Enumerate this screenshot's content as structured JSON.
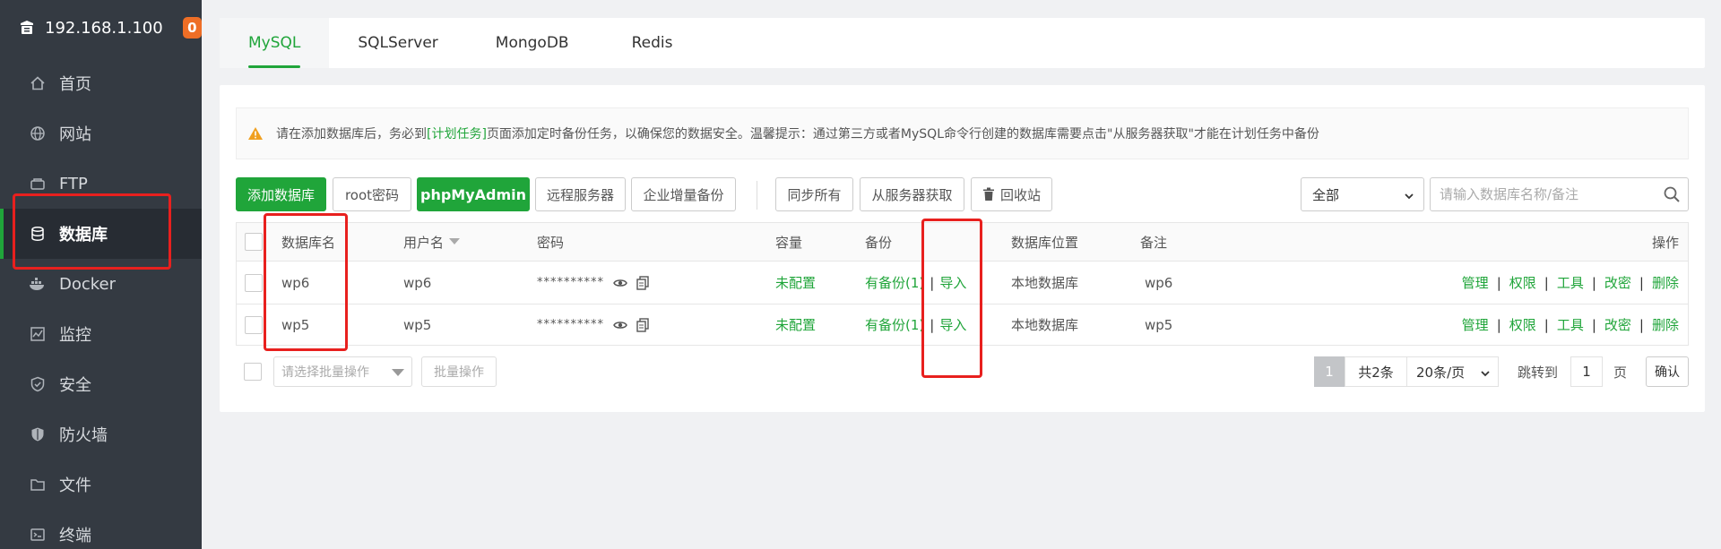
{
  "sidebar": {
    "host": "192.168.1.100",
    "badge": "0",
    "items": [
      {
        "label": "首页",
        "icon": "home-icon"
      },
      {
        "label": "网站",
        "icon": "globe-icon"
      },
      {
        "label": "FTP",
        "icon": "ftp-icon"
      },
      {
        "label": "数据库",
        "icon": "database-icon"
      },
      {
        "label": "Docker",
        "icon": "docker-icon"
      },
      {
        "label": "监控",
        "icon": "monitor-icon"
      },
      {
        "label": "安全",
        "icon": "shield-icon"
      },
      {
        "label": "防火墙",
        "icon": "firewall-icon"
      },
      {
        "label": "文件",
        "icon": "folder-icon"
      },
      {
        "label": "终端",
        "icon": "terminal-icon"
      }
    ]
  },
  "tabs": [
    "MySQL",
    "SQLServer",
    "MongoDB",
    "Redis"
  ],
  "notice": {
    "pre": "请在添加数据库后，务必到",
    "link": "[计划任务]",
    "post": "页面添加定时备份任务，以确保您的数据安全。温馨提示：通过第三方或者MySQL命令行创建的数据库需要点击\"从服务器获取\"才能在计划任务中备份"
  },
  "toolbar": {
    "add_db": "添加数据库",
    "root_pwd": "root密码",
    "phpmyadmin": "phpMyAdmin",
    "remote_server": "远程服务器",
    "incremental_backup": "企业增量备份",
    "sync_all": "同步所有",
    "fetch_from_server": "从服务器获取",
    "recycle_bin": "回收站",
    "filter_value": "全部",
    "search_placeholder": "请输入数据库名称/备注"
  },
  "table": {
    "headers": {
      "name": "数据库名",
      "user": "用户名",
      "password": "密码",
      "capacity": "容量",
      "backup": "备份",
      "location": "数据库位置",
      "remark": "备注",
      "actions": "操作"
    },
    "rows": [
      {
        "name": "wp6",
        "user": "wp6",
        "password": "**********",
        "capacity": "未配置",
        "backup": "有备份(1)",
        "import": "导入",
        "location": "本地数据库",
        "remark": "wp6"
      },
      {
        "name": "wp5",
        "user": "wp5",
        "password": "**********",
        "capacity": "未配置",
        "backup": "有备份(1)",
        "import": "导入",
        "location": "本地数据库",
        "remark": "wp5"
      }
    ],
    "row_actions": [
      "管理",
      "权限",
      "工具",
      "改密",
      "删除"
    ]
  },
  "footer": {
    "batch_placeholder": "请选择批量操作",
    "batch_button": "批量操作",
    "current_page": "1",
    "total": "共2条",
    "page_size": "20条/页",
    "jump_label": "跳转到",
    "jump_value": "1",
    "page_unit": "页",
    "confirm": "确认"
  },
  "colors": {
    "accent": "#20a53a",
    "sidebar_bg": "#343a42",
    "highlight_box": "#e8201e"
  }
}
